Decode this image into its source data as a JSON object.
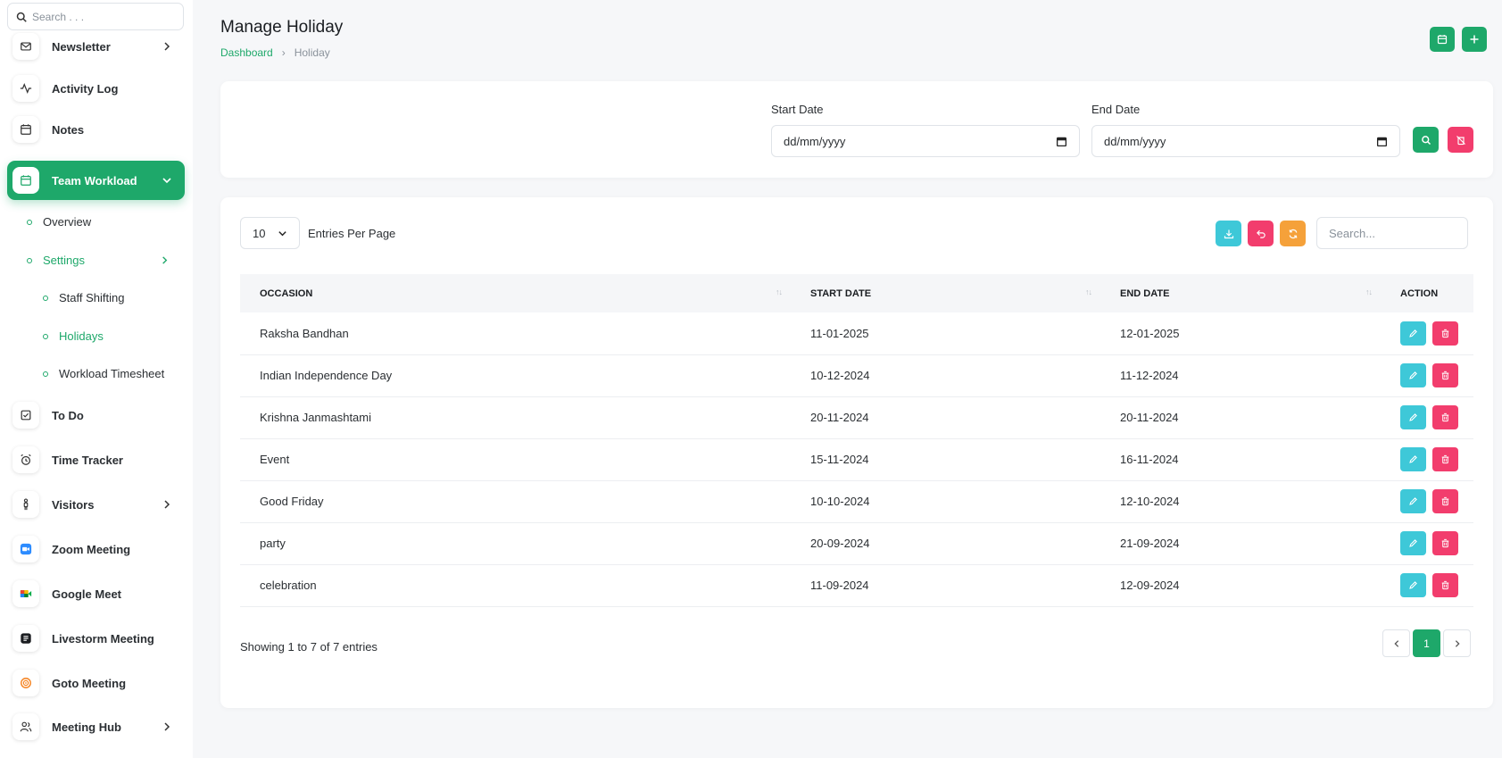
{
  "sidebar": {
    "search_placeholder": "Search . . .",
    "items": [
      {
        "label": "Newsletter",
        "icon": "mail-icon"
      },
      {
        "label": "Activity Log",
        "icon": "activity-icon"
      },
      {
        "label": "Notes",
        "icon": "calendar-icon"
      },
      {
        "label": "Team Workload",
        "icon": "calendar-icon"
      },
      {
        "label": "To Do",
        "icon": "checkbox-icon"
      },
      {
        "label": "Time Tracker",
        "icon": "alarm-icon"
      },
      {
        "label": "Visitors",
        "icon": "person-icon"
      },
      {
        "label": "Zoom Meeting",
        "icon": "zoom-icon"
      },
      {
        "label": "Google Meet",
        "icon": "google-meet-icon"
      },
      {
        "label": "Livestorm Meeting",
        "icon": "livestorm-icon"
      },
      {
        "label": "Goto Meeting",
        "icon": "goto-icon"
      },
      {
        "label": "Meeting Hub",
        "icon": "users-icon"
      }
    ],
    "submenu": {
      "overview": "Overview",
      "settings": "Settings",
      "staff_shifting": "Staff Shifting",
      "holidays": "Holidays",
      "workload_timesheet": "Workload Timesheet"
    }
  },
  "header": {
    "title": "Manage Holiday",
    "breadcrumb": {
      "root": "Dashboard",
      "current": "Holiday"
    }
  },
  "filter": {
    "start_label": "Start Date",
    "end_label": "End Date",
    "start_value": "dd/mm/yyyy",
    "end_value": "dd/mm/yyyy"
  },
  "table": {
    "per_page_value": "10",
    "per_page_label": "Entries Per Page",
    "search_placeholder": "Search...",
    "columns": [
      "OCCASION",
      "START DATE",
      "END DATE",
      "ACTION"
    ],
    "rows": [
      {
        "occasion": "Raksha Bandhan",
        "start": "11-01-2025",
        "end": "12-01-2025"
      },
      {
        "occasion": "Indian Independence Day",
        "start": "10-12-2024",
        "end": "11-12-2024"
      },
      {
        "occasion": "Krishna Janmashtami",
        "start": "20-11-2024",
        "end": "20-11-2024"
      },
      {
        "occasion": "Event",
        "start": "15-11-2024",
        "end": "16-11-2024"
      },
      {
        "occasion": "Good Friday",
        "start": "10-10-2024",
        "end": "12-10-2024"
      },
      {
        "occasion": "party",
        "start": "20-09-2024",
        "end": "21-09-2024"
      },
      {
        "occasion": "celebration",
        "start": "11-09-2024",
        "end": "12-09-2024"
      }
    ],
    "showing": "Showing 1 to 7 of 7 entries",
    "current_page": "1"
  },
  "colors": {
    "primary": "#1ea86a",
    "info": "#3ec8d8",
    "danger": "#f23d6d",
    "warning": "#f5a13a"
  }
}
